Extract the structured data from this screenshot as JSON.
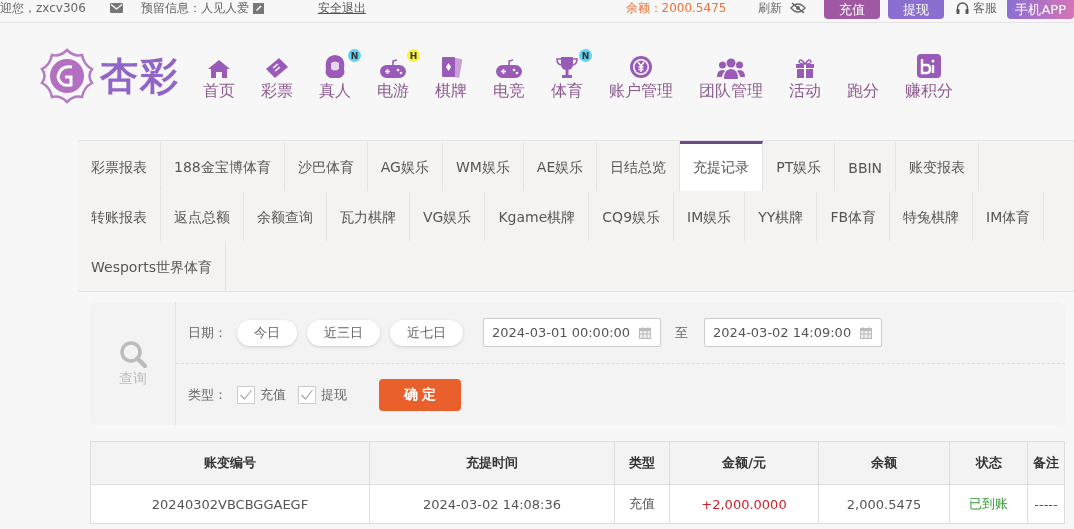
{
  "top_bar": {
    "welcome": "迎您，zxcv306",
    "reserved_info": "预留信息：人见人爱",
    "logout": "安全退出",
    "balance": "余额：2000.5475",
    "refresh": "刷新",
    "buttons": [
      {
        "label": "充值",
        "kind": "deposit"
      },
      {
        "label": "提现",
        "kind": "withdraw"
      }
    ],
    "service": "客服",
    "app_button": "手机APP"
  },
  "logo": {
    "text": "杏彩"
  },
  "nav": [
    {
      "label": "首页"
    },
    {
      "label": "彩票"
    },
    {
      "label": "真人",
      "badge": {
        "text": "N",
        "color": "#5fd3f3"
      }
    },
    {
      "label": "电游",
      "badge": {
        "text": "H",
        "color": "#f7f23c"
      }
    },
    {
      "label": "棋牌"
    },
    {
      "label": "电竞"
    },
    {
      "label": "体育",
      "badge": {
        "text": "N",
        "color": "#5fd3f3"
      }
    },
    {
      "label": "账户管理"
    },
    {
      "label": "团队管理"
    },
    {
      "label": "活动"
    },
    {
      "label": "跑分"
    },
    {
      "label": "赚积分"
    }
  ],
  "tab_rows": [
    [
      {
        "label": "彩票报表",
        "selected": false
      },
      {
        "label": "188金宝博体育",
        "selected": false
      },
      {
        "label": "沙巴体育",
        "selected": false
      },
      {
        "label": "AG娱乐",
        "selected": false
      },
      {
        "label": "WM娱乐",
        "selected": false
      },
      {
        "label": "AE娱乐",
        "selected": false
      },
      {
        "label": "日结总览",
        "selected": false
      },
      {
        "label": "充提记录",
        "selected": true
      },
      {
        "label": "PT娱乐",
        "selected": false
      },
      {
        "label": "BBIN",
        "selected": false
      },
      {
        "label": "账变报表",
        "selected": false
      }
    ],
    [
      {
        "label": "转账报表",
        "selected": false
      },
      {
        "label": "返点总额",
        "selected": false
      },
      {
        "label": "余额查询",
        "selected": false
      },
      {
        "label": "瓦力棋牌",
        "selected": false
      },
      {
        "label": "VG娱乐",
        "selected": false
      },
      {
        "label": "Kgame棋牌",
        "selected": false
      },
      {
        "label": "CQ9娱乐",
        "selected": false
      },
      {
        "label": "IM娱乐",
        "selected": false
      },
      {
        "label": "YY棋牌",
        "selected": false
      },
      {
        "label": "FB体育",
        "selected": false
      },
      {
        "label": "特兔棋牌",
        "selected": false
      },
      {
        "label": "IM体育",
        "selected": false
      }
    ],
    [
      {
        "label": "Wesports世界体育",
        "selected": false
      }
    ]
  ],
  "query": {
    "label": "查询",
    "date_label": "日期：",
    "quick_dates": [
      "今日",
      "近三日",
      "近七日"
    ],
    "date_from": "2024-03-01 00:00:00",
    "to": "至",
    "date_to": "2024-03-02 14:09:00",
    "type_label": "类型：",
    "types": [
      {
        "label": "充值",
        "checked": true
      },
      {
        "label": "提现",
        "checked": true
      }
    ],
    "confirm": "确 定"
  },
  "table": {
    "columns": [
      "账变编号",
      "充提时间",
      "类型",
      "金额/元",
      "余额",
      "状态",
      "备注"
    ],
    "rows": [
      {
        "cells": [
          "20240302VBCBGGAEGF",
          "2024-03-02 14:08:36",
          "充值",
          "+2,000.0000",
          "2,000.5475",
          "已到账",
          "-----"
        ]
      }
    ]
  }
}
